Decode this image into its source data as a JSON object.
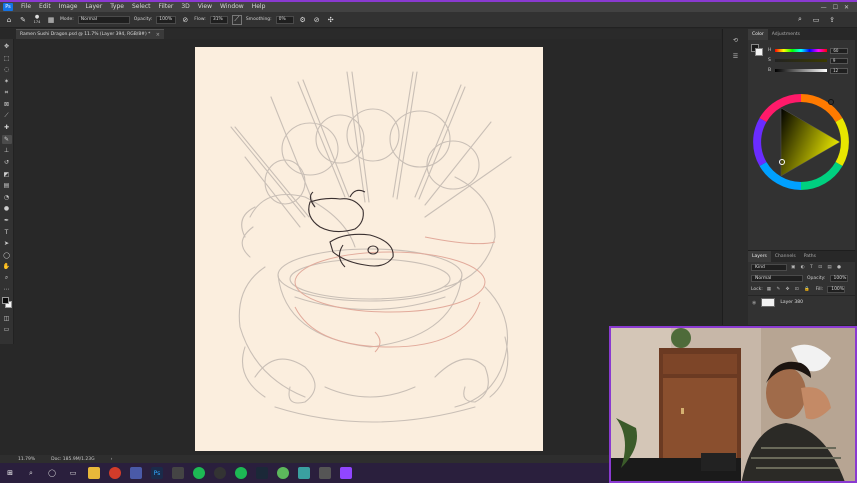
{
  "menubar": {
    "items": [
      "File",
      "Edit",
      "Image",
      "Layer",
      "Type",
      "Select",
      "Filter",
      "3D",
      "View",
      "Window",
      "Help"
    ],
    "window_controls": [
      "—",
      "☐",
      "✕"
    ]
  },
  "options": {
    "brush_size": "174",
    "mode_label": "Mode:",
    "mode_value": "Normal",
    "opacity_label": "Opacity:",
    "opacity_value": "100%",
    "flow_label": "Flow:",
    "flow_value": "31%",
    "smoothing_label": "Smoothing:",
    "smoothing_value": "0%"
  },
  "document": {
    "tab_title": "Ramen Sushi Dragon.psd @ 11.7% (Layer 394, RGB/8#) *",
    "close": "×"
  },
  "status": {
    "zoom": "11.79%",
    "doc": "Doc: 185.9M/1.23G",
    "arrow": "›"
  },
  "color_panel": {
    "tabs": [
      "Color",
      "Adjustments"
    ],
    "h_label": "H",
    "h_value": "60",
    "s_label": "S",
    "s_value": "9",
    "b_label": "B",
    "b_value": "12",
    "accent": "#e8e600"
  },
  "layers_panel": {
    "tabs": [
      "Layers",
      "Channels",
      "Paths"
    ],
    "kind_label": "Kind",
    "blend_mode": "Normal",
    "opacity_label": "Opacity:",
    "opacity_value": "100%",
    "lock_label": "Lock:",
    "fill_label": "Fill:",
    "fill_value": "100%",
    "layer_name": "Layer 380"
  }
}
